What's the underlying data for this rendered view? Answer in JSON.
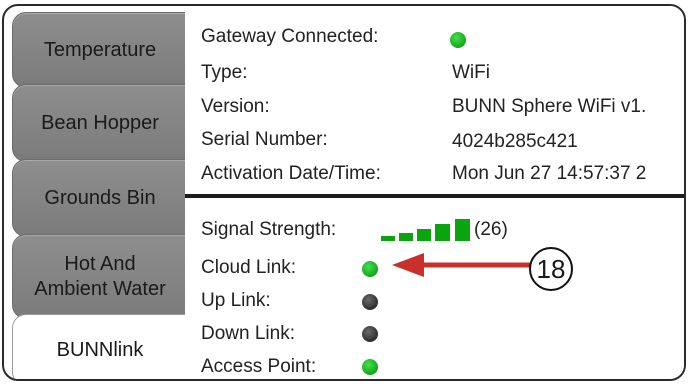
{
  "tabs": [
    {
      "label": "Temperature"
    },
    {
      "label": "Bean Hopper"
    },
    {
      "label": "Grounds Bin"
    },
    {
      "label_line1": "Hot And",
      "label_line2": "Ambient Water"
    },
    {
      "label": "BUNNlink"
    }
  ],
  "gateway": {
    "connected_label": "Gateway Connected:",
    "type_label": "Type:",
    "type_value": "WiFi",
    "version_label": "Version:",
    "version_value": "BUNN Sphere WiFi v1.",
    "serial_label": "Serial Number:",
    "serial_value": "4024b285c421",
    "activation_label": "Activation Date/Time:",
    "activation_value": "Mon Jun 27 14:57:37 2"
  },
  "status": {
    "signal_label": "Signal Strength:",
    "signal_value": "(26)",
    "cloud_label": "Cloud Link:",
    "up_label": "Up Link:",
    "down_label": "Down Link:",
    "access_label": "Access Point:"
  },
  "callout": {
    "number": "18"
  },
  "colors": {
    "green": "#0aa40f",
    "arrow": "#c9302c",
    "tab_gray": "#858585"
  },
  "indicators": {
    "gateway": "green",
    "cloud": "green",
    "up": "dark",
    "down": "dark",
    "access": "green"
  }
}
